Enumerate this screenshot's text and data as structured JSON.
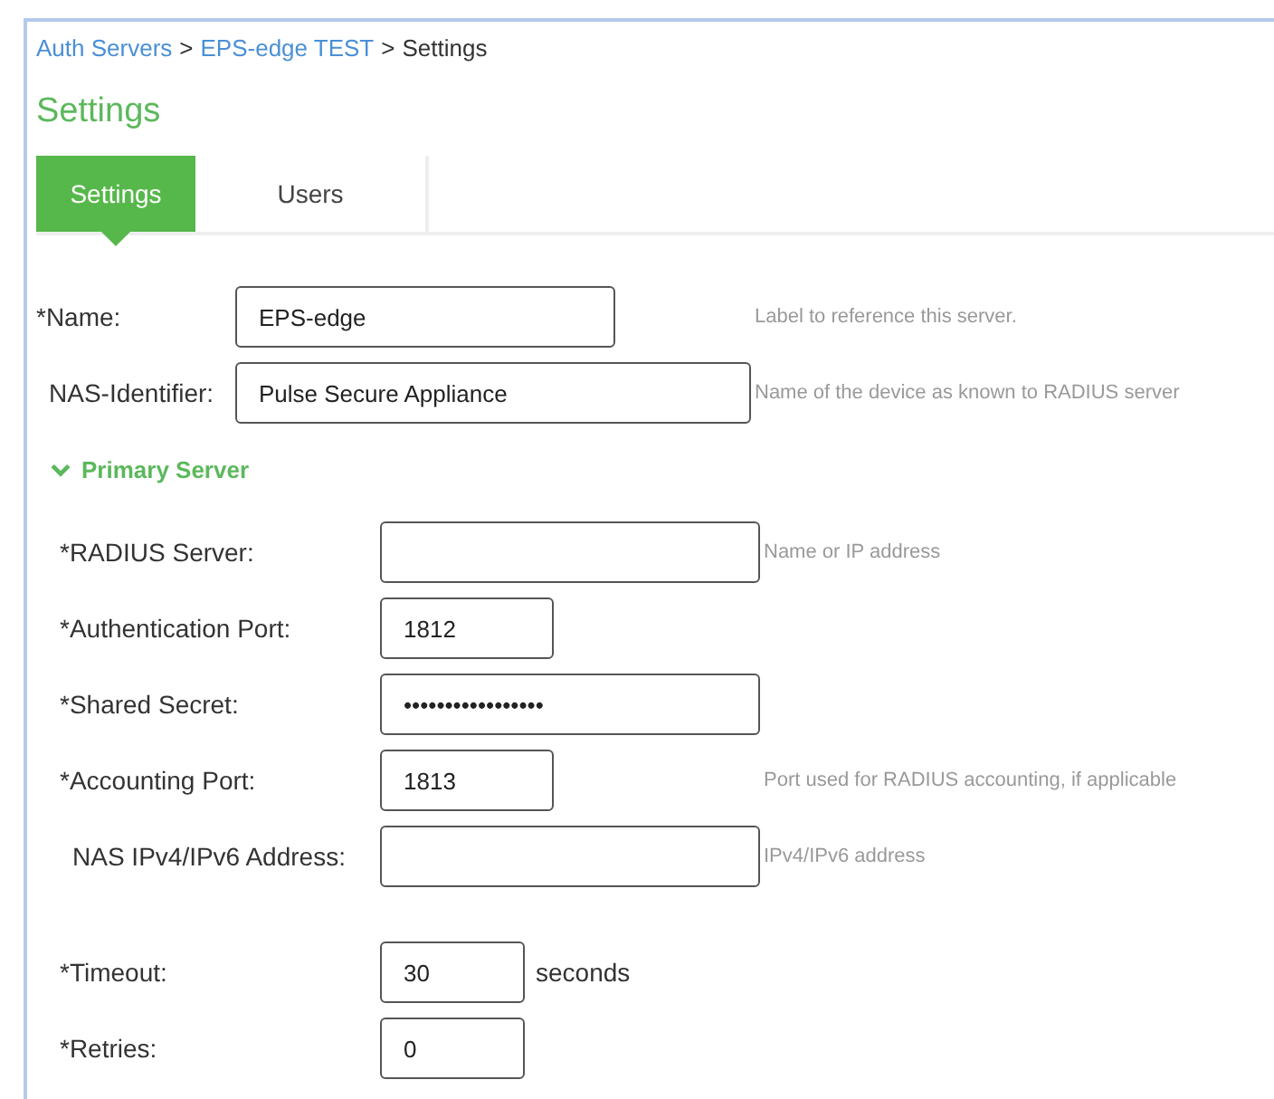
{
  "breadcrumb": [
    {
      "label": "Auth Servers",
      "kind": "link"
    },
    {
      "label": ">",
      "kind": "separator"
    },
    {
      "label": "EPS-edge TEST",
      "kind": "link"
    },
    {
      "label": ">",
      "kind": "separator"
    },
    {
      "label": "Settings",
      "kind": "current"
    }
  ],
  "title": "Settings",
  "tabs": [
    {
      "label": "Settings",
      "selected": true
    },
    {
      "label": "Users",
      "selected": false
    }
  ],
  "fields": [
    {
      "label": "*Name:",
      "value": "EPS-edge",
      "hint": "Label to reference this server.",
      "kind": "name"
    },
    {
      "label": "NAS-Identifier:",
      "value": "Pulse Secure Appliance",
      "hint": "Name of the device as known to RADIUS server",
      "kind": "identifier"
    }
  ],
  "primary_server": {
    "title": "Primary Server",
    "expanded": true,
    "fields": [
      {
        "label": "*RADIUS Server:",
        "hint": "Name or IP address",
        "kind": "long"
      },
      {
        "label": "*Authentication Port:",
        "value": "1812",
        "kind": "port"
      },
      {
        "label": "*Shared Secret:",
        "value": "•••••••••••••••••",
        "kind": "long"
      },
      {
        "label": "*Accounting Port:",
        "value": "1813",
        "hint": "Port used for RADIUS accounting, if applicable",
        "kind": "port"
      },
      {
        "label": "NAS IPv4/IPv6 Address:",
        "hint": "IPv4/IPv6 address",
        "kind": "long"
      }
    ],
    "timing": [
      {
        "label": "*Timeout:",
        "value": "30",
        "suffix": "seconds",
        "kind": "short"
      },
      {
        "label": "*Retries:",
        "value": "0",
        "kind": "short"
      }
    ]
  }
}
